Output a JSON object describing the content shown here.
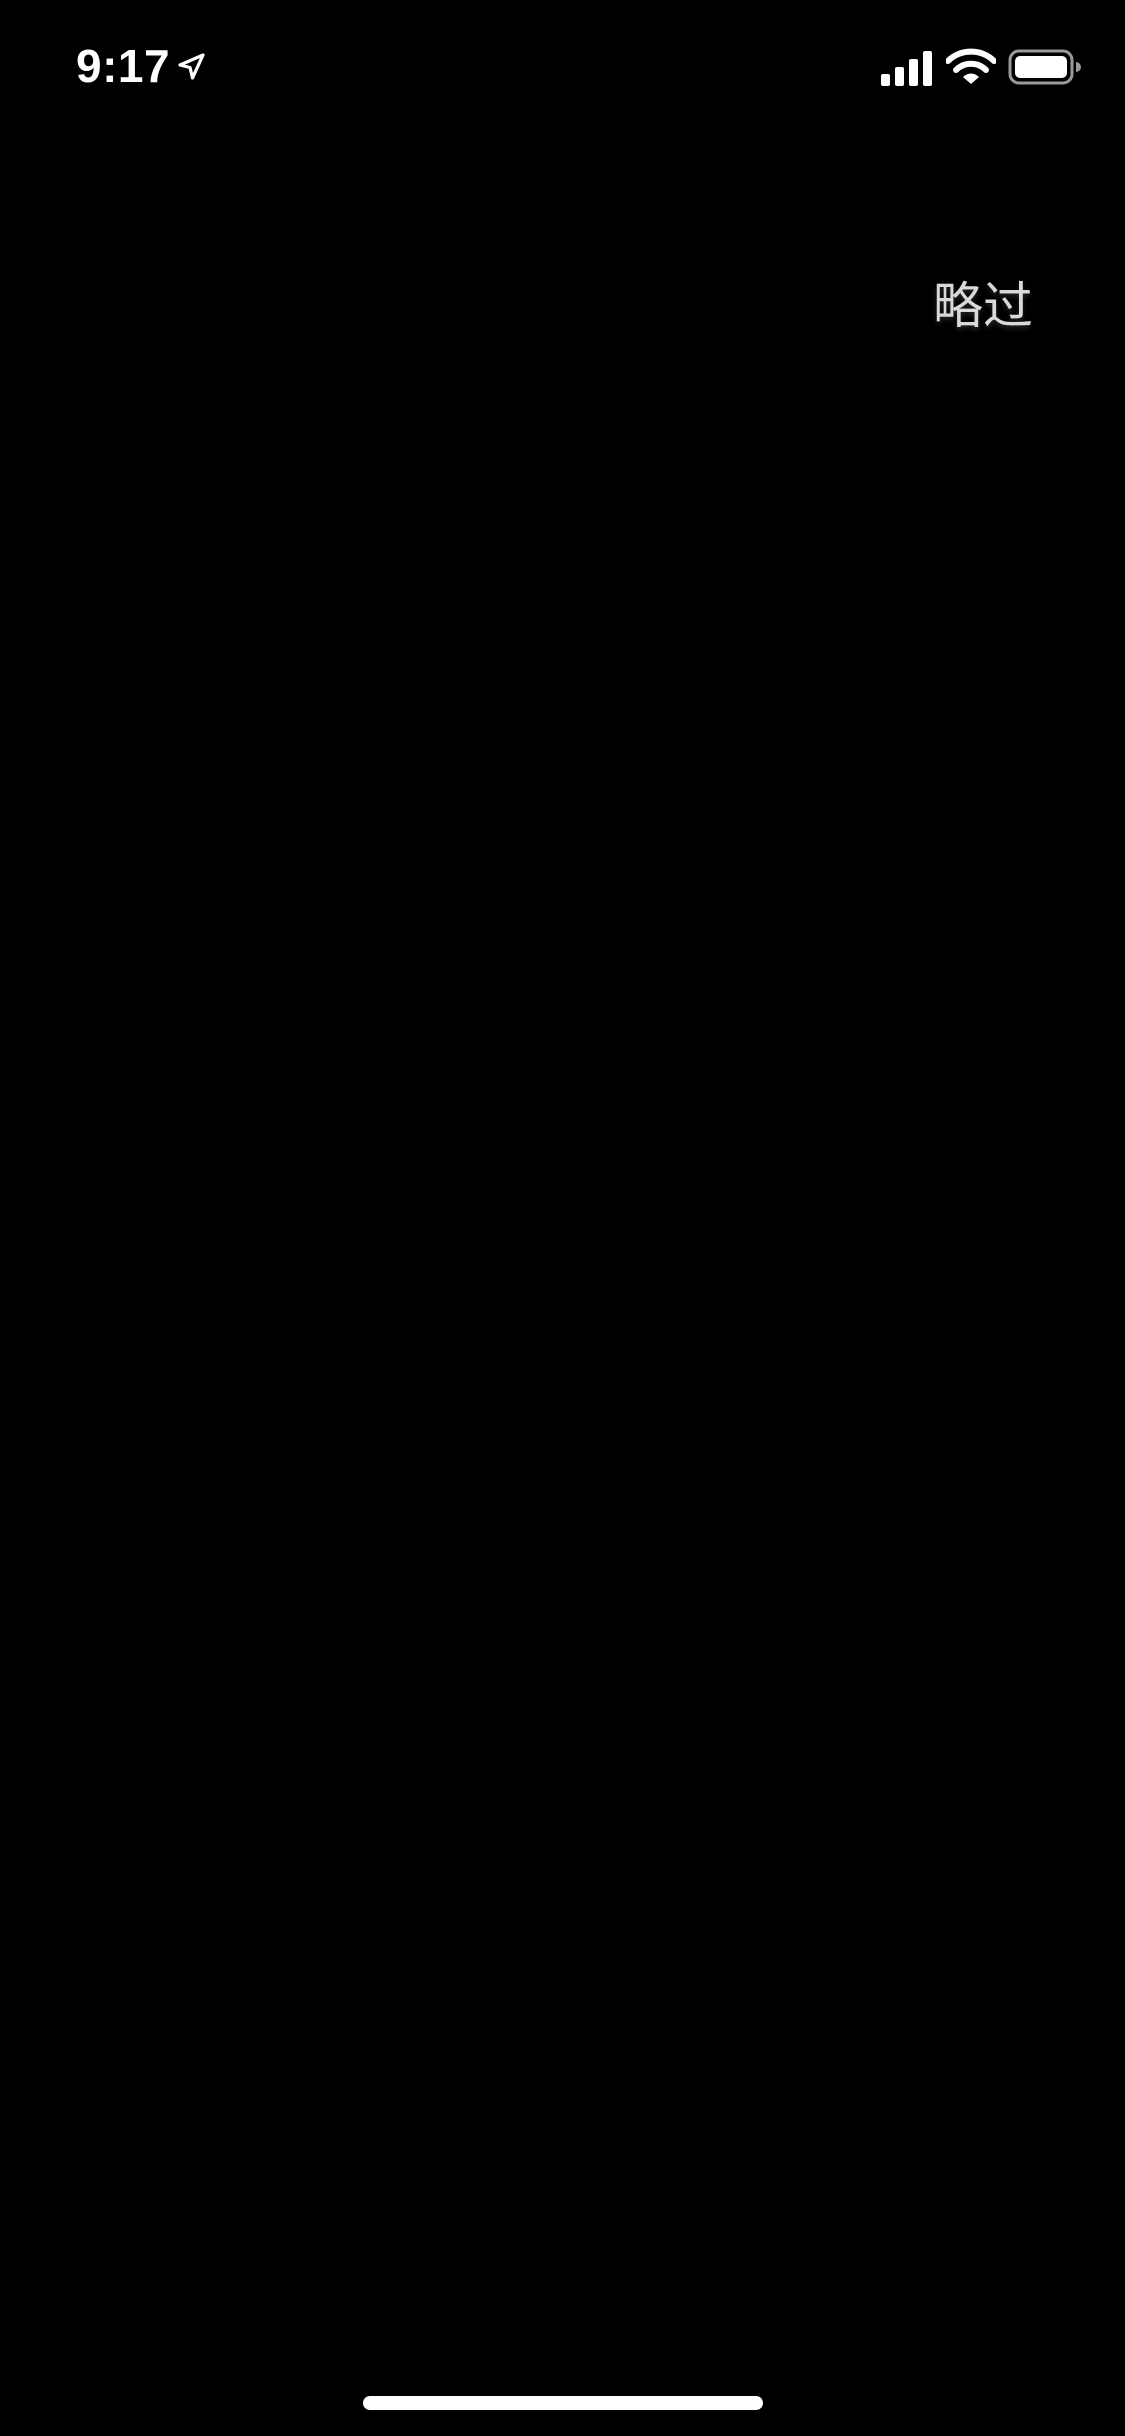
{
  "status_bar": {
    "time": "9:17",
    "icons": [
      "location-arrow-icon",
      "cellular-signal-icon",
      "wifi-icon",
      "battery-icon"
    ]
  },
  "skip_button": {
    "label": "略过"
  },
  "colors": {
    "background": "#000000",
    "status_text": "#ffffff",
    "skip_text": "#d9d9d9",
    "home_indicator": "#ffffff"
  }
}
